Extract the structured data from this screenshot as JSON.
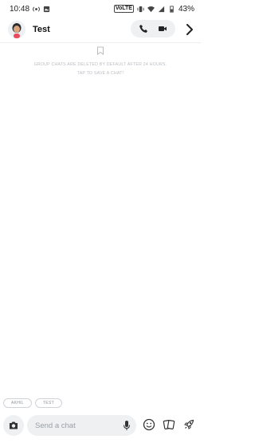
{
  "status_bar": {
    "time": "10:48",
    "battery": "43%",
    "badge": "VoLTE"
  },
  "header": {
    "title": "Test"
  },
  "notice": {
    "line1": "GROUP CHATS ARE DELETED BY DEFAULT AFTER 24 HOURS.",
    "line2": "TAP TO SAVE A CHAT!"
  },
  "chips": [
    {
      "label": "AKHIL"
    },
    {
      "label": "TEST"
    }
  ],
  "composer": {
    "placeholder": "Send a chat"
  },
  "icons": {
    "camera": "camera-icon",
    "mic": "mic-icon",
    "emoji": "emoji-icon",
    "stickers": "cards-icon",
    "rocket": "rocket-icon",
    "phone": "phone-icon",
    "video": "video-icon",
    "chevron": "chevron-right-icon"
  }
}
